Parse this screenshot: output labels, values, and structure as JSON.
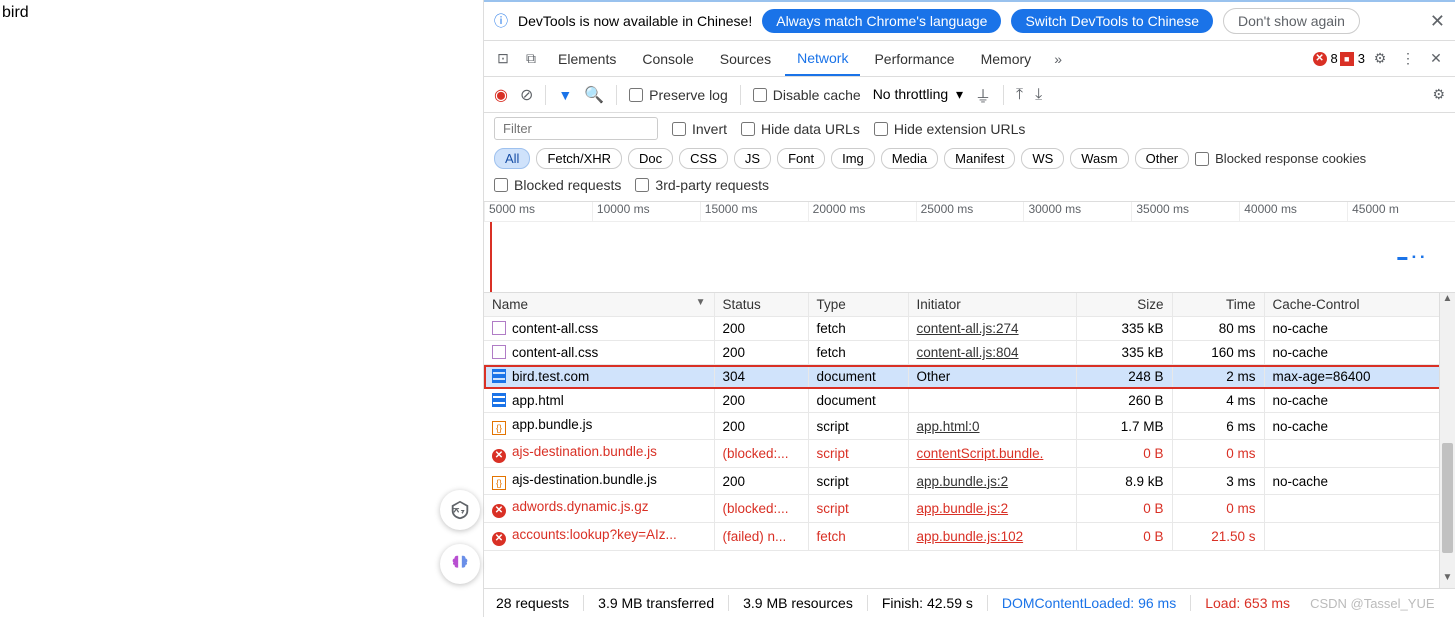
{
  "page": {
    "text": "bird"
  },
  "banner": {
    "message": "DevTools is now available in Chinese!",
    "always_btn": "Always match Chrome's language",
    "switch_btn": "Switch DevTools to Chinese",
    "dont_show": "Don't show again"
  },
  "tabs": {
    "elements": "Elements",
    "console": "Console",
    "sources": "Sources",
    "network": "Network",
    "performance": "Performance",
    "memory": "Memory",
    "err_count": "8",
    "warn_count": "3"
  },
  "toolbar": {
    "preserve": "Preserve log",
    "disable_cache": "Disable cache",
    "throttling": "No throttling"
  },
  "filter": {
    "placeholder": "Filter",
    "invert": "Invert",
    "hide_data": "Hide data URLs",
    "hide_ext": "Hide extension URLs"
  },
  "chips": {
    "all": "All",
    "fetch": "Fetch/XHR",
    "doc": "Doc",
    "css": "CSS",
    "js": "JS",
    "font": "Font",
    "img": "Img",
    "media": "Media",
    "manifest": "Manifest",
    "ws": "WS",
    "wasm": "Wasm",
    "other": "Other",
    "blocked_cookies": "Blocked response cookies",
    "blocked_req": "Blocked requests",
    "third_party": "3rd-party requests"
  },
  "timeline": {
    "ticks": [
      "5000 ms",
      "10000 ms",
      "15000 ms",
      "20000 ms",
      "25000 ms",
      "30000 ms",
      "35000 ms",
      "40000 ms",
      "45000 m"
    ]
  },
  "columns": {
    "name": "Name",
    "status": "Status",
    "type": "Type",
    "initiator": "Initiator",
    "size": "Size",
    "time": "Time",
    "cache": "Cache-Control"
  },
  "rows": [
    {
      "icon": "file",
      "name": "content-all.css",
      "status": "200",
      "type": "fetch",
      "initiator": "content-all.js:274",
      "size": "335 kB",
      "time": "80 ms",
      "cache": "no-cache",
      "err": false,
      "sel": false
    },
    {
      "icon": "file",
      "name": "content-all.css",
      "status": "200",
      "type": "fetch",
      "initiator": "content-all.js:804",
      "size": "335 kB",
      "time": "160 ms",
      "cache": "no-cache",
      "err": false,
      "sel": false
    },
    {
      "icon": "doc",
      "name": "bird.test.com",
      "status": "304",
      "type": "document",
      "initiator": "Other",
      "init_link": false,
      "size": "248 B",
      "time": "2 ms",
      "cache": "max-age=86400",
      "err": false,
      "sel": true
    },
    {
      "icon": "doc",
      "name": "app.html",
      "status": "200",
      "type": "document",
      "initiator": "",
      "size": "260 B",
      "time": "4 ms",
      "cache": "no-cache",
      "err": false,
      "sel": false
    },
    {
      "icon": "js",
      "name": "app.bundle.js",
      "status": "200",
      "type": "script",
      "initiator": "app.html:0",
      "size": "1.7 MB",
      "time": "6 ms",
      "cache": "no-cache",
      "err": false,
      "sel": false
    },
    {
      "icon": "err",
      "name": "ajs-destination.bundle.js",
      "status": "(blocked:...",
      "type": "script",
      "initiator": "contentScript.bundle.",
      "size": "0 B",
      "time": "0 ms",
      "cache": "",
      "err": true,
      "sel": false
    },
    {
      "icon": "js",
      "name": "ajs-destination.bundle.js",
      "status": "200",
      "type": "script",
      "initiator": "app.bundle.js:2",
      "size": "8.9 kB",
      "time": "3 ms",
      "cache": "no-cache",
      "err": false,
      "sel": false
    },
    {
      "icon": "err",
      "name": "adwords.dynamic.js.gz",
      "status": "(blocked:...",
      "type": "script",
      "initiator": "app.bundle.js:2",
      "size": "0 B",
      "time": "0 ms",
      "cache": "",
      "err": true,
      "sel": false
    },
    {
      "icon": "err",
      "name": "accounts:lookup?key=AIz...",
      "status": "(failed) n...",
      "type": "fetch",
      "initiator": "app.bundle.js:102",
      "size": "0 B",
      "time": "21.50 s",
      "cache": "",
      "err": true,
      "sel": false
    }
  ],
  "status": {
    "requests": "28 requests",
    "transferred": "3.9 MB transferred",
    "resources": "3.9 MB resources",
    "finish": "Finish: 42.59 s",
    "dom": "DOMContentLoaded: 96 ms",
    "load": "Load: 653 ms",
    "watermark": "CSDN @Tassel_YUE"
  }
}
